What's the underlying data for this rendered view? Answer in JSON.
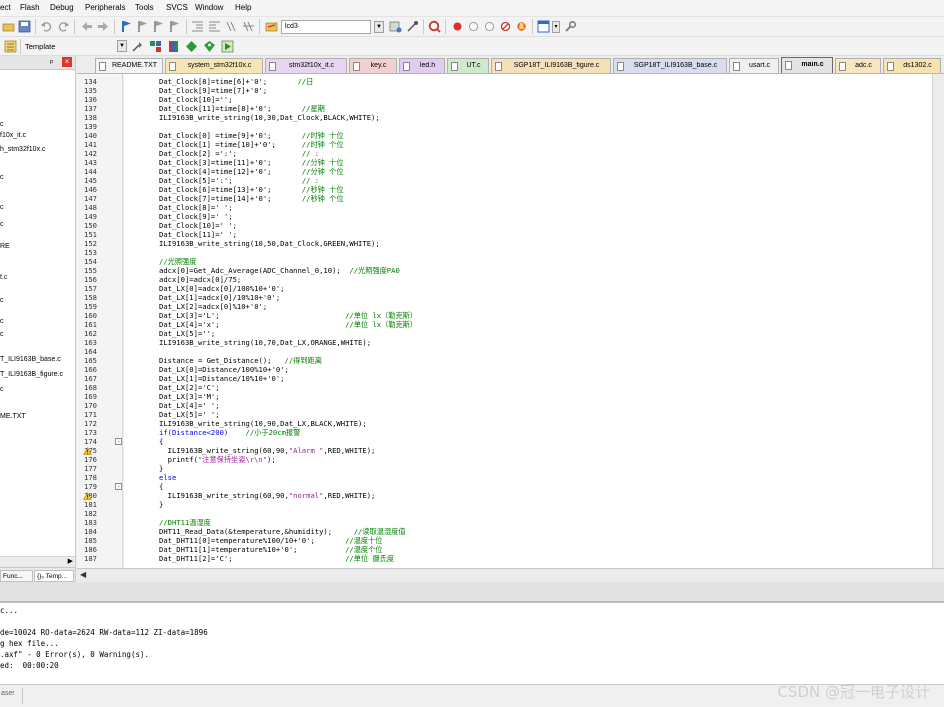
{
  "menubar": {
    "items": [
      "ect",
      "Flash",
      "Debug",
      "Peripherals",
      "Tools",
      "SVCS",
      "Window",
      "Help"
    ]
  },
  "toolbar1": {
    "target_combo": "lcd3"
  },
  "toolbar2": {
    "template_label": "Template"
  },
  "project_panel": {
    "pin_glyph": "ᵖ",
    "close_glyph": "×",
    "tree_items": [
      "c",
      "f10x_it.c",
      "h_stm32f10x.c",
      "c",
      "c",
      "c",
      "RE",
      "t.c",
      "c",
      "c",
      "c",
      "T_ILI9163B_base.c",
      "T_ILI9163B_figure.c",
      "c",
      "ME.TXT"
    ],
    "bottom_tabs": [
      "Func...",
      "{}₀ Temp..."
    ]
  },
  "tabs": [
    {
      "label": "README.TXT",
      "color": "#f4f4f4",
      "active": false
    },
    {
      "label": "system_stm32f10x.c",
      "color": "#f6e6b4",
      "active": false
    },
    {
      "label": "stm32f10x_it.c",
      "color": "#e6d6f0",
      "active": false
    },
    {
      "label": "key.c",
      "color": "#f3d0d0",
      "active": false
    },
    {
      "label": "led.h",
      "color": "#e0ccf0",
      "active": false
    },
    {
      "label": "UT.c",
      "color": "#cfe9cf",
      "active": false
    },
    {
      "label": "SGP18T_ILI9163B_figure.c",
      "color": "#f6e0b8",
      "active": false
    },
    {
      "label": "SGP18T_ILI9163B_base.c",
      "color": "#d8dcef",
      "active": false
    },
    {
      "label": "usart.c",
      "color": "#f0f0f0",
      "active": false
    },
    {
      "label": "main.c",
      "color": "#e4e4e4",
      "active": true
    },
    {
      "label": "adc.c",
      "color": "#f8e6c0",
      "active": false
    },
    {
      "label": "ds1302.c",
      "color": "#f7e3b0",
      "active": false
    }
  ],
  "editor": {
    "lines": [
      {
        "n": "134",
        "t": "Dat_Clock[8]=time[6]+'0';",
        "c": "       //日"
      },
      {
        "n": "135",
        "t": "Dat_Clock[9]=time[7]+'0';",
        "c": ""
      },
      {
        "n": "136",
        "t": "Dat_Clock[10]='';",
        "c": ""
      },
      {
        "n": "137",
        "t": "Dat_Clock[11]=time[8]+'0';",
        "c": "       //星期"
      },
      {
        "n": "138",
        "t": "ILI9163B_write_string(10,30,Dat_Clock,BLACK,WHITE);",
        "c": ""
      },
      {
        "n": "139",
        "t": "",
        "c": ""
      },
      {
        "n": "140",
        "t": "Dat_Clock[0] =time[9]+'0';",
        "c": "       //时钟 十位"
      },
      {
        "n": "141",
        "t": "Dat_Clock[1] =time[10]+'0';",
        "c": "      //时钟 个位"
      },
      {
        "n": "142",
        "t": "Dat_Clock[2] =':';",
        "c": "               // :"
      },
      {
        "n": "143",
        "t": "Dat_Clock[3]=time[11]+'0';",
        "c": "       //分钟 十位"
      },
      {
        "n": "144",
        "t": "Dat_Clock[4]=time[12]+'0';",
        "c": "       //分钟 个位"
      },
      {
        "n": "145",
        "t": "Dat_Clock[5]=':';",
        "c": "                // :"
      },
      {
        "n": "146",
        "t": "Dat_Clock[6]=time[13]+'0';",
        "c": "       //秒钟 十位"
      },
      {
        "n": "147",
        "t": "Dat_Clock[7]=time[14]+'0';",
        "c": "       //秒钟 个位"
      },
      {
        "n": "148",
        "t": "Dat_Clock[8]=' ';",
        "c": ""
      },
      {
        "n": "149",
        "t": "Dat_Clock[9]=' ';",
        "c": ""
      },
      {
        "n": "150",
        "t": "Dat_Clock[10]=' ';",
        "c": ""
      },
      {
        "n": "151",
        "t": "Dat_Clock[11]=' ';",
        "c": ""
      },
      {
        "n": "152",
        "t": "ILI9163B_write_string(10,50,Dat_Clock,GREEN,WHITE);",
        "c": ""
      },
      {
        "n": "153",
        "t": "",
        "c": ""
      },
      {
        "n": "154",
        "t": "",
        "c": "//光照强度"
      },
      {
        "n": "155",
        "t": "adcx[0]=Get_Adc_Average(ADC_Channel_0,10);",
        "c": "  //光照强度PA0"
      },
      {
        "n": "156",
        "t": "adcx[0]=adcx[0]/75;",
        "c": ""
      },
      {
        "n": "157",
        "t": "Dat_LX[0]=adcx[0]/100%10+'0';",
        "c": ""
      },
      {
        "n": "158",
        "t": "Dat_LX[1]=adcx[0]/10%10+'0';",
        "c": ""
      },
      {
        "n": "159",
        "t": "Dat_LX[2]=adcx[0]%10+'0';",
        "c": ""
      },
      {
        "n": "160",
        "t": "Dat_LX[3]='L';",
        "c": "                             //单位 lx（勒克斯）"
      },
      {
        "n": "161",
        "t": "Dat_LX[4]='x';",
        "c": "                             //单位 lx（勒克斯）"
      },
      {
        "n": "162",
        "t": "Dat_LX[5]='';",
        "c": ""
      },
      {
        "n": "163",
        "t": "ILI9163B_write_string(10,70,Dat_LX,ORANGE,WHITE);",
        "c": ""
      },
      {
        "n": "164",
        "t": "",
        "c": ""
      },
      {
        "n": "165",
        "t": "Distance = Get_Distance();",
        "c": "   //得到距离"
      },
      {
        "n": "166",
        "t": "Dat_LX[0]=Distance/100%10+'0';",
        "c": ""
      },
      {
        "n": "167",
        "t": "Dat_LX[1]=Distance/10%10+'0';",
        "c": ""
      },
      {
        "n": "168",
        "t": "Dat_LX[2]='C';",
        "c": ""
      },
      {
        "n": "169",
        "t": "Dat_LX[3]='M';",
        "c": ""
      },
      {
        "n": "170",
        "t": "Dat_LX[4]=' ';",
        "c": ""
      },
      {
        "n": "171",
        "t": "Dat_LX[5]=' ';",
        "c": ""
      },
      {
        "n": "172",
        "t": "ILI9163B_write_string(10,90,Dat_LX,BLACK,WHITE);",
        "c": ""
      },
      {
        "n": "173",
        "t": "if(Distance<200)",
        "c": "    //小于20cm报警"
      },
      {
        "n": "174",
        "t": "{",
        "c": ""
      },
      {
        "n": "175",
        "t": "  ILI9163B_write_string(60,90,\"Alarm \",RED,WHITE);",
        "c": ""
      },
      {
        "n": "176",
        "t": "  printf(\"注意保持坐姿\\r\\n\");",
        "c": ""
      },
      {
        "n": "177",
        "t": "}",
        "c": ""
      },
      {
        "n": "178",
        "t": "else",
        "c": ""
      },
      {
        "n": "179",
        "t": "{",
        "c": ""
      },
      {
        "n": "180",
        "t": "  ILI9163B_write_string(60,90,\"normal\",RED,WHITE);",
        "c": ""
      },
      {
        "n": "181",
        "t": "}",
        "c": ""
      },
      {
        "n": "182",
        "t": "",
        "c": ""
      },
      {
        "n": "183",
        "t": "",
        "c": "//DHT11温湿度"
      },
      {
        "n": "184",
        "t": "DHT11_Read_Data(&temperature,&humidity);",
        "c": "     //读取温湿度值"
      },
      {
        "n": "185",
        "t": "Dat_DHT11[0]=temperature%100/10+'0';",
        "c": "       //温度十位"
      },
      {
        "n": "186",
        "t": "Dat_DHT11[1]=temperature%10+'0';",
        "c": "           //温度个位"
      },
      {
        "n": "187",
        "t": "Dat_DHT11[2]='C';",
        "c": "                          //单位 摄氏度"
      }
    ]
  },
  "build_output": {
    "lines": [
      "c...",
      "",
      "de=10024 RO-data=2624 RW-data=112 ZI-data=1896",
      "g hex file...",
      ".axf\" - 0 Error(s), 0 Warning(s).",
      "ed:  00:00:20"
    ]
  },
  "status": {
    "left_text": "aser"
  },
  "watermark": {
    "text": "CSDN @冠一电子设计"
  }
}
